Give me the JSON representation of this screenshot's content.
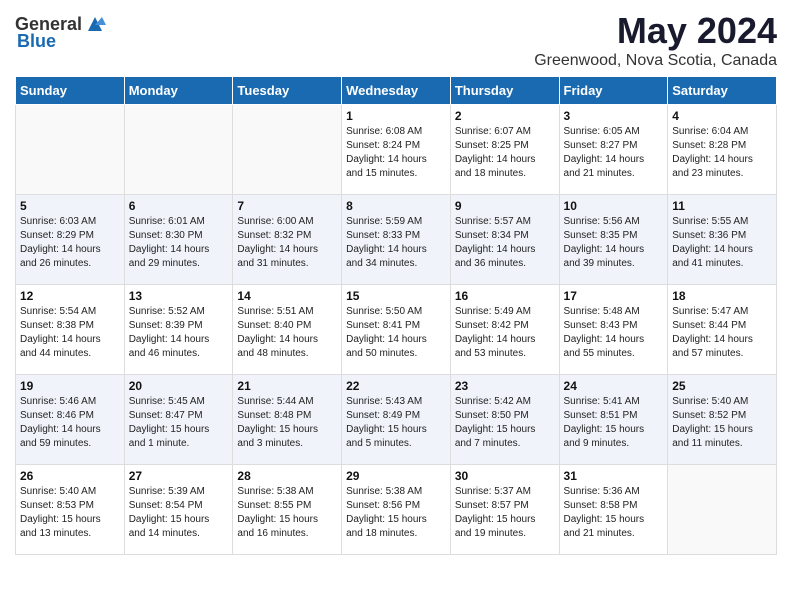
{
  "logo": {
    "general": "General",
    "blue": "Blue"
  },
  "header": {
    "title": "May 2024",
    "subtitle": "Greenwood, Nova Scotia, Canada"
  },
  "weekdays": [
    "Sunday",
    "Monday",
    "Tuesday",
    "Wednesday",
    "Thursday",
    "Friday",
    "Saturday"
  ],
  "weeks": [
    [
      {
        "day": "",
        "info": ""
      },
      {
        "day": "",
        "info": ""
      },
      {
        "day": "",
        "info": ""
      },
      {
        "day": "1",
        "info": "Sunrise: 6:08 AM\nSunset: 8:24 PM\nDaylight: 14 hours\nand 15 minutes."
      },
      {
        "day": "2",
        "info": "Sunrise: 6:07 AM\nSunset: 8:25 PM\nDaylight: 14 hours\nand 18 minutes."
      },
      {
        "day": "3",
        "info": "Sunrise: 6:05 AM\nSunset: 8:27 PM\nDaylight: 14 hours\nand 21 minutes."
      },
      {
        "day": "4",
        "info": "Sunrise: 6:04 AM\nSunset: 8:28 PM\nDaylight: 14 hours\nand 23 minutes."
      }
    ],
    [
      {
        "day": "5",
        "info": "Sunrise: 6:03 AM\nSunset: 8:29 PM\nDaylight: 14 hours\nand 26 minutes."
      },
      {
        "day": "6",
        "info": "Sunrise: 6:01 AM\nSunset: 8:30 PM\nDaylight: 14 hours\nand 29 minutes."
      },
      {
        "day": "7",
        "info": "Sunrise: 6:00 AM\nSunset: 8:32 PM\nDaylight: 14 hours\nand 31 minutes."
      },
      {
        "day": "8",
        "info": "Sunrise: 5:59 AM\nSunset: 8:33 PM\nDaylight: 14 hours\nand 34 minutes."
      },
      {
        "day": "9",
        "info": "Sunrise: 5:57 AM\nSunset: 8:34 PM\nDaylight: 14 hours\nand 36 minutes."
      },
      {
        "day": "10",
        "info": "Sunrise: 5:56 AM\nSunset: 8:35 PM\nDaylight: 14 hours\nand 39 minutes."
      },
      {
        "day": "11",
        "info": "Sunrise: 5:55 AM\nSunset: 8:36 PM\nDaylight: 14 hours\nand 41 minutes."
      }
    ],
    [
      {
        "day": "12",
        "info": "Sunrise: 5:54 AM\nSunset: 8:38 PM\nDaylight: 14 hours\nand 44 minutes."
      },
      {
        "day": "13",
        "info": "Sunrise: 5:52 AM\nSunset: 8:39 PM\nDaylight: 14 hours\nand 46 minutes."
      },
      {
        "day": "14",
        "info": "Sunrise: 5:51 AM\nSunset: 8:40 PM\nDaylight: 14 hours\nand 48 minutes."
      },
      {
        "day": "15",
        "info": "Sunrise: 5:50 AM\nSunset: 8:41 PM\nDaylight: 14 hours\nand 50 minutes."
      },
      {
        "day": "16",
        "info": "Sunrise: 5:49 AM\nSunset: 8:42 PM\nDaylight: 14 hours\nand 53 minutes."
      },
      {
        "day": "17",
        "info": "Sunrise: 5:48 AM\nSunset: 8:43 PM\nDaylight: 14 hours\nand 55 minutes."
      },
      {
        "day": "18",
        "info": "Sunrise: 5:47 AM\nSunset: 8:44 PM\nDaylight: 14 hours\nand 57 minutes."
      }
    ],
    [
      {
        "day": "19",
        "info": "Sunrise: 5:46 AM\nSunset: 8:46 PM\nDaylight: 14 hours\nand 59 minutes."
      },
      {
        "day": "20",
        "info": "Sunrise: 5:45 AM\nSunset: 8:47 PM\nDaylight: 15 hours\nand 1 minute."
      },
      {
        "day": "21",
        "info": "Sunrise: 5:44 AM\nSunset: 8:48 PM\nDaylight: 15 hours\nand 3 minutes."
      },
      {
        "day": "22",
        "info": "Sunrise: 5:43 AM\nSunset: 8:49 PM\nDaylight: 15 hours\nand 5 minutes."
      },
      {
        "day": "23",
        "info": "Sunrise: 5:42 AM\nSunset: 8:50 PM\nDaylight: 15 hours\nand 7 minutes."
      },
      {
        "day": "24",
        "info": "Sunrise: 5:41 AM\nSunset: 8:51 PM\nDaylight: 15 hours\nand 9 minutes."
      },
      {
        "day": "25",
        "info": "Sunrise: 5:40 AM\nSunset: 8:52 PM\nDaylight: 15 hours\nand 11 minutes."
      }
    ],
    [
      {
        "day": "26",
        "info": "Sunrise: 5:40 AM\nSunset: 8:53 PM\nDaylight: 15 hours\nand 13 minutes."
      },
      {
        "day": "27",
        "info": "Sunrise: 5:39 AM\nSunset: 8:54 PM\nDaylight: 15 hours\nand 14 minutes."
      },
      {
        "day": "28",
        "info": "Sunrise: 5:38 AM\nSunset: 8:55 PM\nDaylight: 15 hours\nand 16 minutes."
      },
      {
        "day": "29",
        "info": "Sunrise: 5:38 AM\nSunset: 8:56 PM\nDaylight: 15 hours\nand 18 minutes."
      },
      {
        "day": "30",
        "info": "Sunrise: 5:37 AM\nSunset: 8:57 PM\nDaylight: 15 hours\nand 19 minutes."
      },
      {
        "day": "31",
        "info": "Sunrise: 5:36 AM\nSunset: 8:58 PM\nDaylight: 15 hours\nand 21 minutes."
      },
      {
        "day": "",
        "info": ""
      }
    ]
  ]
}
